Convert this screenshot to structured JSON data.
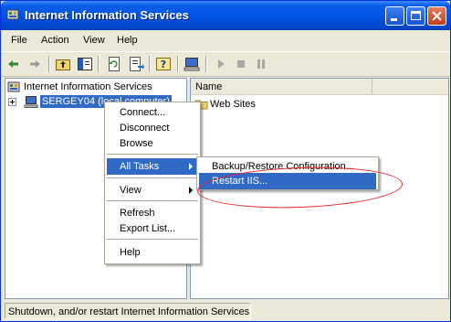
{
  "window": {
    "title": "Internet Information Services"
  },
  "menubar": {
    "items": [
      "File",
      "Action",
      "View",
      "Help"
    ]
  },
  "tree": {
    "root": "Internet Information Services",
    "computer": "SERGEY04 (local computer)"
  },
  "list": {
    "column_name": "Name",
    "items": [
      "Web Sites"
    ]
  },
  "context_menu": {
    "items": [
      "Connect...",
      "Disconnect",
      "Browse",
      "All Tasks",
      "View",
      "Refresh",
      "Export List...",
      "Help"
    ]
  },
  "submenu": {
    "items": [
      "Backup/Restore Configuration...",
      "Restart IIS..."
    ]
  },
  "status": {
    "text": "Shutdown, and/or restart Internet Information Services"
  },
  "colors": {
    "highlight": "#316ac5",
    "annotation": "#e8272a",
    "titlebar": "#0055e5"
  },
  "icons": [
    "back-icon",
    "forward-icon",
    "up-folder-icon",
    "show-tree-icon",
    "refresh-icon",
    "export-icon",
    "help-icon",
    "computer-icon",
    "play-icon",
    "stop-icon",
    "pause-icon"
  ]
}
